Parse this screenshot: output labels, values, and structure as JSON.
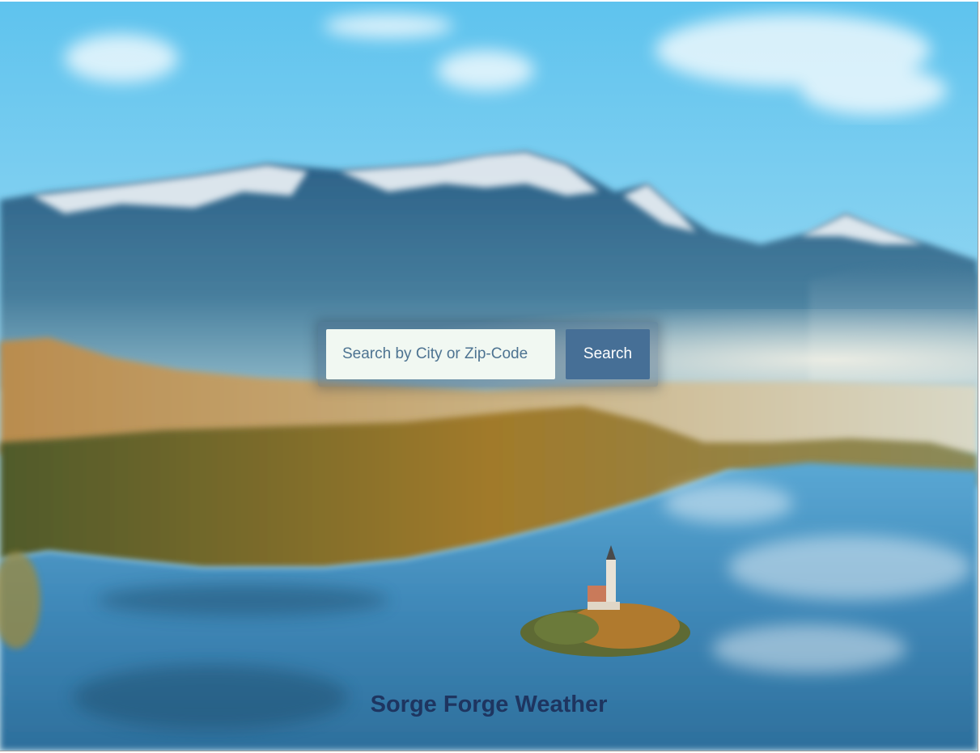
{
  "search": {
    "placeholder": "Search by City or Zip-Code",
    "value": "",
    "button_label": "Search"
  },
  "footer": {
    "title": "Sorge Forge Weather"
  },
  "colors": {
    "button": "#466f96",
    "input_background": "#f1f8f2",
    "title": "#1e3560"
  }
}
